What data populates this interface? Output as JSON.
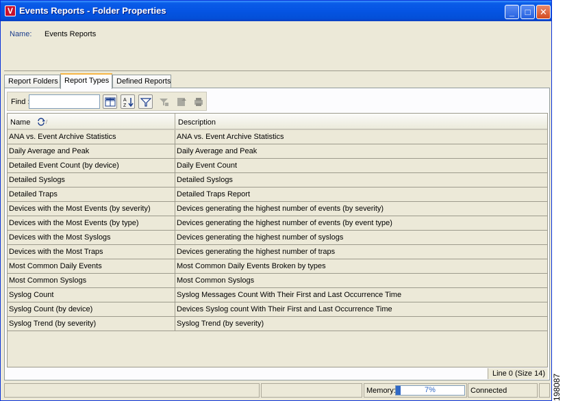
{
  "window": {
    "title": "Events Reports - Folder Properties",
    "icon_letter": "V",
    "minimize_glyph": "_",
    "maximize_glyph": "□",
    "close_glyph": "✕"
  },
  "header": {
    "name_label": "Name:",
    "name_value": "Events Reports"
  },
  "tabs": [
    {
      "label": "Report Folders",
      "active": false
    },
    {
      "label": "Report Types",
      "active": true
    },
    {
      "label": "Defined Reports",
      "active": false
    }
  ],
  "toolbar": {
    "find_label": "Find :",
    "find_value": "",
    "icons": [
      "column-chooser-icon",
      "sort-az-icon",
      "filter-icon",
      "filter-clear-icon",
      "export-icon",
      "print-icon"
    ]
  },
  "table": {
    "columns": [
      "Name",
      "Description"
    ],
    "sort_icon": "sort-ascending-icon",
    "rows": [
      [
        "ANA vs. Event Archive Statistics",
        "ANA vs. Event Archive Statistics"
      ],
      [
        "Daily Average and Peak",
        "Daily Average and Peak"
      ],
      [
        "Detailed Event Count (by device)",
        "Daily Event Count"
      ],
      [
        "Detailed Syslogs",
        "Detailed Syslogs"
      ],
      [
        "Detailed Traps",
        "Detailed Traps Report"
      ],
      [
        "Devices with the Most Events (by severity)",
        "Devices generating the highest number of events (by severity)"
      ],
      [
        "Devices with the Most Events (by type)",
        "Devices generating the highest number of events (by event type)"
      ],
      [
        "Devices with the Most Syslogs",
        "Devices generating the highest number of syslogs"
      ],
      [
        "Devices with the Most Traps",
        "Devices generating the highest number of traps"
      ],
      [
        "Most Common Daily Events",
        "Most Common Daily Events Broken by types"
      ],
      [
        "Most Common Syslogs",
        "Most Common Syslogs"
      ],
      [
        "Syslog Count",
        "Syslog Messages Count With Their First and Last Occurrence Time"
      ],
      [
        "Syslog Count (by device)",
        "Devices Syslog count With Their First and Last Occurrence Time"
      ],
      [
        "Syslog Trend (by severity)",
        "Syslog Trend (by severity)"
      ]
    ]
  },
  "panel_status": {
    "line_info": "Line 0 (Size 14)"
  },
  "status_bar": {
    "memory_label": "Memory:",
    "memory_percent": 7,
    "memory_text": "7%",
    "connection": "Connected"
  },
  "figure_id": "198087",
  "colors": {
    "title_bar": "#0554e3",
    "window_bg": "#ece9d8",
    "memory_fill": "#3169c6"
  }
}
